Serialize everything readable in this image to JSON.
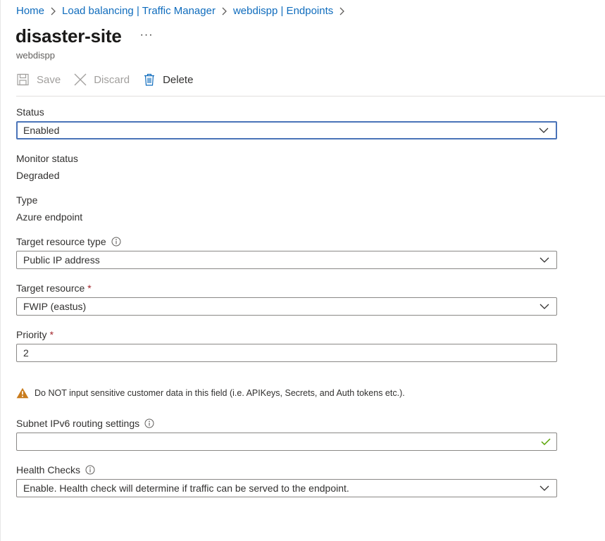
{
  "breadcrumb": {
    "items": [
      "Home",
      "Load balancing | Traffic Manager",
      "webdispp | Endpoints"
    ]
  },
  "header": {
    "title": "disaster-site",
    "more": "···",
    "subtitle": "webdispp"
  },
  "toolbar": {
    "save_label": "Save",
    "discard_label": "Discard",
    "delete_label": "Delete"
  },
  "form": {
    "status": {
      "label": "Status",
      "value": "Enabled"
    },
    "monitor_status": {
      "label": "Monitor status",
      "value": "Degraded"
    },
    "type": {
      "label": "Type",
      "value": "Azure endpoint"
    },
    "target_resource_type": {
      "label": "Target resource type",
      "value": "Public IP address"
    },
    "target_resource": {
      "label": "Target resource",
      "required_mark": "*",
      "value": "FWIP (eastus)"
    },
    "priority": {
      "label": "Priority",
      "required_mark": "*",
      "value": "2"
    },
    "warning": "Do NOT input sensitive customer data in this field (i.e. APIKeys, Secrets, and Auth tokens etc.).",
    "subnet": {
      "label": "Subnet IPv6 routing settings",
      "value": ""
    },
    "health_checks": {
      "label": "Health Checks",
      "value": "Enable. Health check will determine if traffic can be served to the endpoint."
    }
  },
  "colors": {
    "link": "#0f6cbd",
    "focus_border": "#4a73b8",
    "required": "#a4262c",
    "warning_icon": "#c97c1d",
    "valid_check": "#57a300"
  }
}
